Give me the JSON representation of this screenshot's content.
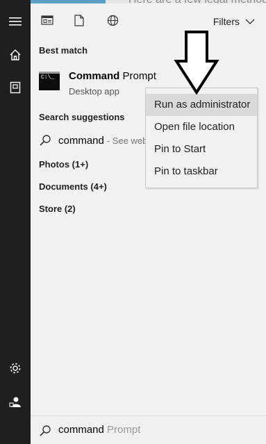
{
  "background": {
    "partial_text": "Here are a few legal method"
  },
  "sidebar": {
    "icons": [
      "hamburger-menu-icon",
      "home-icon",
      "documents-icon",
      "settings-icon",
      "user-icon"
    ]
  },
  "toolbar": {
    "icons": [
      "apps-icon",
      "document-icon",
      "web-icon"
    ],
    "filters_label": "Filters"
  },
  "best_match": {
    "header": "Best match",
    "app_name_bold": "Command",
    "app_name_rest": " Prompt",
    "app_subtitle": "Desktop app",
    "app_icon_text": "C:\\_"
  },
  "search_suggestions": {
    "header": "Search suggestions",
    "query": "command",
    "hint": "- See web results"
  },
  "categories": [
    {
      "label": "Photos (1+)"
    },
    {
      "label": "Documents (4+)"
    },
    {
      "label": "Store (2)"
    }
  ],
  "context_menu": {
    "items": [
      "Run as administrator",
      "Open file location",
      "Pin to Start",
      "Pin to taskbar"
    ],
    "highlighted_index": 0
  },
  "search_box": {
    "typed": "command",
    "suggestion": " Prompt"
  },
  "colors": {
    "sidebar": "#1f1f1f",
    "panel": "#f2f2f2",
    "highlight": "#dadada"
  }
}
